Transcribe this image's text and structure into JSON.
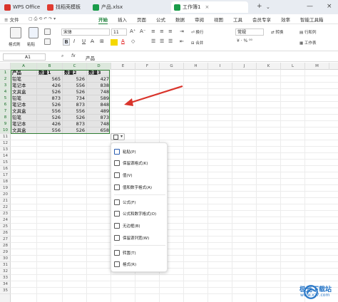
{
  "titlebar": {
    "tabs": [
      {
        "label": "WPS Office",
        "icon": "wps-logo-icon",
        "color": "#d9342b"
      },
      {
        "label": "找稻壳模板",
        "icon": "docer-icon",
        "color": "#e03c31"
      },
      {
        "label": "产品.xlsx",
        "icon": "spreadsheet-icon",
        "color": "#1a9c4a"
      },
      {
        "label": "工作簿1",
        "icon": "spreadsheet-icon",
        "color": "#1a9c4a"
      }
    ],
    "new_tab": "+",
    "minimize": "—",
    "close": "×"
  },
  "menubar": {
    "file": "≡ 文件",
    "items": [
      "开始",
      "插入",
      "页面",
      "公式",
      "数据",
      "审阅",
      "视图",
      "工具",
      "会员专享",
      "效率",
      "智能工具箱"
    ],
    "active": "开始"
  },
  "ribbon": {
    "format_painter": "格式刷",
    "paste": "粘贴",
    "font_name": "宋体",
    "font_size": "11",
    "bold": "B",
    "italic": "I",
    "underline": "U",
    "wrap": "换行",
    "merge": "合并",
    "number_format": "常规",
    "convert": "转换",
    "rows_cols": "行和列",
    "worksheet": "工作表",
    "fx": "fx"
  },
  "formula_bar": {
    "cell_ref": "A1",
    "content": "产品"
  },
  "columns": [
    "A",
    "B",
    "C",
    "D",
    "E",
    "F",
    "G",
    "H",
    "I",
    "J",
    "K",
    "L",
    "M"
  ],
  "rows": [
    "1",
    "2",
    "3",
    "4",
    "5",
    "6",
    "7",
    "8",
    "9",
    "10",
    "11",
    "12",
    "13",
    "14",
    "15",
    "16",
    "17",
    "18",
    "19",
    "20",
    "21",
    "22",
    "23",
    "24",
    "25",
    "26",
    "27",
    "28",
    "29",
    "30",
    "31",
    "32",
    "33",
    "34",
    "35"
  ],
  "table": {
    "headers": [
      "产品",
      "数量1",
      "数量2",
      "数量3"
    ],
    "rows": [
      [
        "铅笔",
        "565",
        "526",
        "427"
      ],
      [
        "笔记本",
        "426",
        "556",
        "838"
      ],
      [
        "文具盒",
        "526",
        "526",
        "748"
      ],
      [
        "铅笔",
        "873",
        "734",
        "589"
      ],
      [
        "笔记本",
        "526",
        "873",
        "848"
      ],
      [
        "文具盒",
        "556",
        "556",
        "489"
      ],
      [
        "铅笔",
        "526",
        "526",
        "873"
      ],
      [
        "笔记本",
        "426",
        "873",
        "748"
      ],
      [
        "文具盒",
        "556",
        "526",
        "658"
      ]
    ]
  },
  "paste_menu": {
    "items": [
      "粘贴(P)",
      "保留源格式(K)",
      "值(V)",
      "值和数字格式(A)",
      "公式(F)",
      "公式和数字格式(O)",
      "无边框(B)",
      "保留源列宽(W)",
      "转置(T)",
      "格式(R)"
    ]
  },
  "watermark": {
    "title": "极光下载站",
    "url": "www.xz7.com"
  },
  "colors": {
    "accent": "#1a7f37",
    "selection_border": "#2e7d32",
    "arrow": "#d9342b"
  }
}
